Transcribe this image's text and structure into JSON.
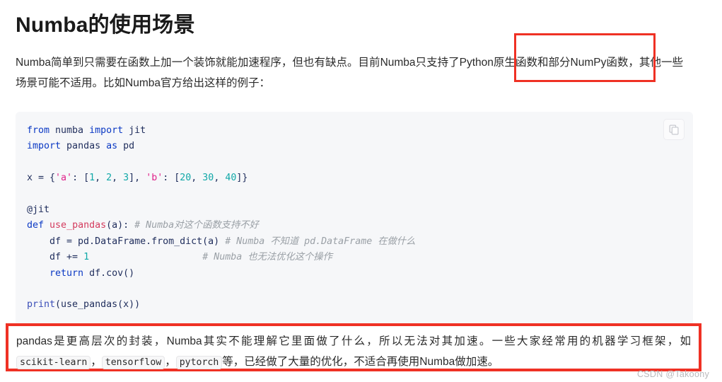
{
  "article": {
    "title": "Numba的使用场景",
    "intro_paragraph": "Numba简单到只需要在函数上加一个装饰就能加速程序，但也有缺点。目前Numba只支持了Python原生函数和部分NumPy函数，其他一些场景可能不适用。比如Numba官方给出这样的例子："
  },
  "code_block": {
    "language": "python",
    "copy_button_title": "复制代码",
    "lines": [
      {
        "segments": [
          {
            "text": "from",
            "type": "keyword"
          },
          {
            "text": " numba ",
            "type": "plain"
          },
          {
            "text": "import",
            "type": "keyword"
          },
          {
            "text": " jit",
            "type": "plain"
          }
        ]
      },
      {
        "segments": [
          {
            "text": "import",
            "type": "keyword"
          },
          {
            "text": " pandas ",
            "type": "plain"
          },
          {
            "text": "as",
            "type": "keyword"
          },
          {
            "text": " pd",
            "type": "plain"
          }
        ]
      },
      {
        "segments": [
          {
            "text": "",
            "type": "plain"
          }
        ]
      },
      {
        "segments": [
          {
            "text": "x = {",
            "type": "plain"
          },
          {
            "text": "'a'",
            "type": "string"
          },
          {
            "text": ": [",
            "type": "plain"
          },
          {
            "text": "1",
            "type": "number"
          },
          {
            "text": ", ",
            "type": "plain"
          },
          {
            "text": "2",
            "type": "number"
          },
          {
            "text": ", ",
            "type": "plain"
          },
          {
            "text": "3",
            "type": "number"
          },
          {
            "text": "], ",
            "type": "plain"
          },
          {
            "text": "'b'",
            "type": "string"
          },
          {
            "text": ": [",
            "type": "plain"
          },
          {
            "text": "20",
            "type": "number"
          },
          {
            "text": ", ",
            "type": "plain"
          },
          {
            "text": "30",
            "type": "number"
          },
          {
            "text": ", ",
            "type": "plain"
          },
          {
            "text": "40",
            "type": "number"
          },
          {
            "text": "]}",
            "type": "plain"
          }
        ]
      },
      {
        "segments": [
          {
            "text": "",
            "type": "plain"
          }
        ]
      },
      {
        "segments": [
          {
            "text": "@jit",
            "type": "plain"
          }
        ]
      },
      {
        "segments": [
          {
            "text": "def",
            "type": "keyword"
          },
          {
            "text": " ",
            "type": "plain"
          },
          {
            "text": "use_pandas",
            "type": "function"
          },
          {
            "text": "(a): ",
            "type": "plain"
          },
          {
            "text": "# Numba对这个函数支持不好",
            "type": "comment"
          }
        ]
      },
      {
        "segments": [
          {
            "text": "    df = pd.DataFrame.from_dict(a) ",
            "type": "plain"
          },
          {
            "text": "# Numba 不知道 pd.DataFrame 在做什么",
            "type": "comment"
          }
        ]
      },
      {
        "segments": [
          {
            "text": "    df += ",
            "type": "plain"
          },
          {
            "text": "1",
            "type": "number"
          },
          {
            "text": "                    ",
            "type": "plain"
          },
          {
            "text": "# Numba 也无法优化这个操作",
            "type": "comment"
          }
        ]
      },
      {
        "segments": [
          {
            "text": "    ",
            "type": "plain"
          },
          {
            "text": "return",
            "type": "keyword"
          },
          {
            "text": " df.cov()",
            "type": "plain"
          }
        ]
      },
      {
        "segments": [
          {
            "text": "",
            "type": "plain"
          }
        ]
      },
      {
        "segments": [
          {
            "text": "print",
            "type": "builtin"
          },
          {
            "text": "(use_pandas(x))",
            "type": "plain"
          }
        ]
      }
    ]
  },
  "bottom_paragraph": {
    "parts": [
      {
        "text": "pandas是更高层次的封装，Numba其实不能理解它里面做了什么，所以无法对其加速。一些大家经常用的机器学习框架，如",
        "type": "text"
      },
      {
        "text": "scikit-learn",
        "type": "code"
      },
      {
        "text": "，",
        "type": "text"
      },
      {
        "text": "tensorflow",
        "type": "code"
      },
      {
        "text": "，",
        "type": "text"
      },
      {
        "text": "pytorch",
        "type": "code"
      },
      {
        "text": "等，已经做了大量的优化，不适合再使用Numba做加速。",
        "type": "text"
      }
    ]
  },
  "annotations": {
    "highlight_color": "#ef3124",
    "top_box_label": "原生函数和部分NumPy函数",
    "bottom_box_label": "pandas是更高层次的封装段落"
  },
  "watermark": {
    "text": "CSDN @Takoony"
  },
  "icons": {
    "copy": "copy-icon"
  }
}
